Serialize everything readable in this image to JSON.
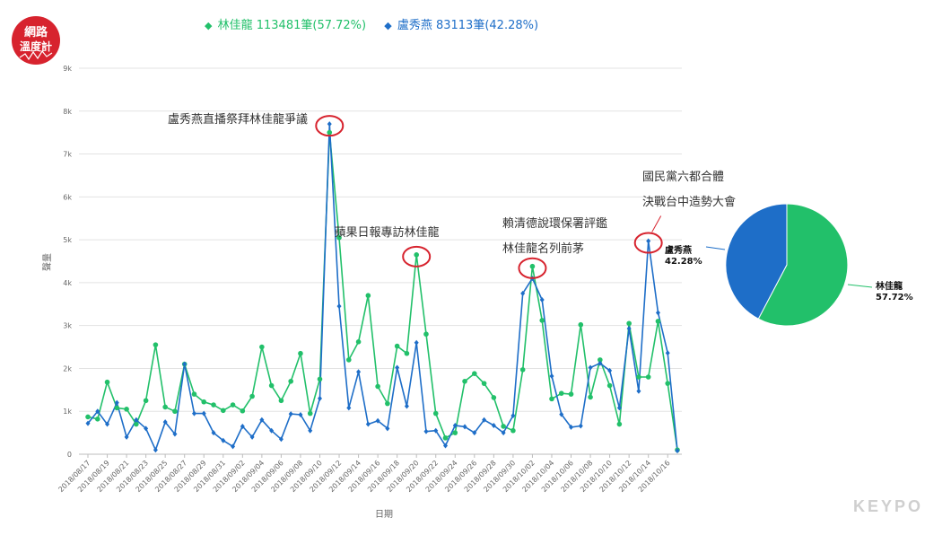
{
  "logo": {
    "line1": "網路",
    "line2": "溫度計"
  },
  "watermark": "KEYPO",
  "legend": {
    "items": [
      {
        "label": "林佳龍 113481筆(57.72%)",
        "color": "#22c06a"
      },
      {
        "label": "盧秀燕 83113筆(42.28%)",
        "color": "#1e6ec8"
      }
    ]
  },
  "annotations": [
    {
      "lines": [
        "盧秀燕直播祭拜林佳龍爭議"
      ],
      "date": "2018/09/11"
    },
    {
      "lines": [
        "蘋果日報專訪林佳龍"
      ],
      "date": "2018/09/20"
    },
    {
      "lines": [
        "賴清德說環保署評鑑",
        "林佳龍名列前茅"
      ],
      "date": "2018/10/02"
    },
    {
      "lines": [
        "國民黨六都合體",
        "決戰台中造勢大會"
      ],
      "date": "2018/10/14"
    }
  ],
  "chart_data": [
    {
      "type": "line",
      "xlabel": "日期",
      "ylabel": "聲量",
      "ylim": [
        0,
        9000
      ],
      "yticks": [
        "0",
        "1k",
        "2k",
        "3k",
        "4k",
        "5k",
        "6k",
        "7k",
        "8k",
        "9k"
      ],
      "grid": true,
      "x": [
        "2018/08/17",
        "2018/08/18",
        "2018/08/19",
        "2018/08/20",
        "2018/08/21",
        "2018/08/22",
        "2018/08/23",
        "2018/08/24",
        "2018/08/25",
        "2018/08/26",
        "2018/08/27",
        "2018/08/28",
        "2018/08/29",
        "2018/08/30",
        "2018/08/31",
        "2018/09/01",
        "2018/09/02",
        "2018/09/03",
        "2018/09/04",
        "2018/09/05",
        "2018/09/06",
        "2018/09/07",
        "2018/09/08",
        "2018/09/09",
        "2018/09/10",
        "2018/09/11",
        "2018/09/12",
        "2018/09/13",
        "2018/09/14",
        "2018/09/15",
        "2018/09/16",
        "2018/09/17",
        "2018/09/18",
        "2018/09/19",
        "2018/09/20",
        "2018/09/21",
        "2018/09/22",
        "2018/09/23",
        "2018/09/24",
        "2018/09/25",
        "2018/09/26",
        "2018/09/27",
        "2018/09/28",
        "2018/09/29",
        "2018/09/30",
        "2018/10/01",
        "2018/10/02",
        "2018/10/03",
        "2018/10/04",
        "2018/10/05",
        "2018/10/06",
        "2018/10/07",
        "2018/10/08",
        "2018/10/09",
        "2018/10/10",
        "2018/10/11",
        "2018/10/12",
        "2018/10/13",
        "2018/10/14",
        "2018/10/15",
        "2018/10/16",
        "2018/10/17"
      ],
      "xtick_labels": [
        "2018/08/17",
        "2018/08/19",
        "2018/08/21",
        "2018/08/23",
        "2018/08/25",
        "2018/08/27",
        "2018/08/29",
        "2018/08/31",
        "2018/09/02",
        "2018/09/04",
        "2018/09/06",
        "2018/09/08",
        "2018/09/10",
        "2018/09/12",
        "2018/09/14",
        "2018/09/16",
        "2018/09/18",
        "2018/09/20",
        "2018/09/22",
        "2018/09/24",
        "2018/09/26",
        "2018/09/28",
        "2018/09/30",
        "2018/10/02",
        "2018/10/04",
        "2018/10/06",
        "2018/10/08",
        "2018/10/10",
        "2018/10/12",
        "2018/10/14",
        "2018/10/16"
      ],
      "series": [
        {
          "name": "林佳龍",
          "color": "#22c06a",
          "values": [
            870,
            820,
            1680,
            1080,
            1050,
            700,
            1250,
            2550,
            1100,
            1000,
            2100,
            1400,
            1220,
            1150,
            1020,
            1150,
            1010,
            1350,
            2500,
            1600,
            1250,
            1700,
            2350,
            950,
            1750,
            7500,
            5050,
            2200,
            2620,
            3700,
            1580,
            1180,
            2520,
            2350,
            4650,
            2800,
            950,
            380,
            500,
            1700,
            1880,
            1650,
            1320,
            650,
            550,
            1970,
            4380,
            3120,
            1290,
            1420,
            1400,
            3020,
            1330,
            2200,
            1600,
            700,
            3050,
            1800,
            1800,
            3100,
            1650,
            100
          ]
        },
        {
          "name": "盧秀燕",
          "color": "#1e6ec8",
          "values": [
            720,
            1000,
            700,
            1200,
            400,
            800,
            600,
            100,
            750,
            470,
            2100,
            950,
            950,
            500,
            320,
            180,
            650,
            400,
            800,
            550,
            350,
            940,
            920,
            550,
            1300,
            7700,
            3450,
            1080,
            1920,
            700,
            780,
            600,
            2020,
            1120,
            2600,
            530,
            550,
            200,
            670,
            640,
            500,
            800,
            670,
            500,
            900,
            3750,
            4100,
            3600,
            1820,
            930,
            630,
            660,
            2020,
            2120,
            1950,
            1080,
            2930,
            1470,
            4970,
            3300,
            2360,
            80
          ]
        }
      ]
    },
    {
      "type": "pie",
      "slices": [
        {
          "label": "林佳龍",
          "pct_label": "57.72%",
          "value": 57.72,
          "color": "#22c06a"
        },
        {
          "label": "盧秀燕",
          "pct_label": "42.28%",
          "value": 42.28,
          "color": "#1e6ec8"
        }
      ]
    }
  ]
}
